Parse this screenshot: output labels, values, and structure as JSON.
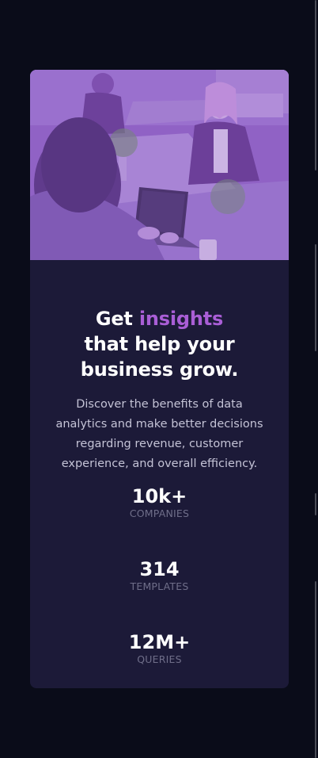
{
  "colors": {
    "page_background": "#0a0c19",
    "card_background": "#1c1a38",
    "accent": "#a95ed6",
    "image_tint": "#8a5cc0",
    "text_primary": "#ffffff",
    "text_body": "#c4c3d6",
    "text_muted": "#6f6e89"
  },
  "hero": {
    "image_description_icon": "office-team-photo"
  },
  "heading": {
    "prefix": "Get ",
    "accent": "insights",
    "suffix": " that help your business grow."
  },
  "description": "Discover the benefits of data analytics and make better decisions regarding revenue, customer experience, and overall efficiency.",
  "stats": [
    {
      "value": "10k+",
      "label": "COMPANIES"
    },
    {
      "value": "314",
      "label": "TEMPLATES"
    },
    {
      "value": "12M+",
      "label": "QUERIES"
    }
  ]
}
